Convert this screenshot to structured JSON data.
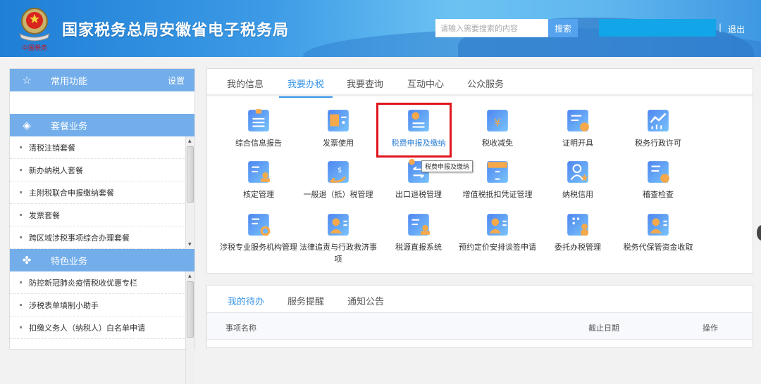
{
  "header": {
    "title": "国家税务总局安徽省电子税务局",
    "logo_text": "中国税务",
    "search_placeholder": "请输入需要搜索的内容",
    "search_button": "搜索",
    "separator": "|",
    "logout": "退出"
  },
  "sidebar": {
    "common": {
      "title": "常用功能",
      "settings": "设置",
      "icon": "star-icon"
    },
    "package": {
      "title": "套餐业务",
      "icon": "layers-icon",
      "items": [
        "清税注销套餐",
        "新办纳税人套餐",
        "主附税联合申报缴纳套餐",
        "发票套餐",
        "跨区域涉税事项综合办理套餐"
      ]
    },
    "special": {
      "title": "特色业务",
      "icon": "clover-icon",
      "items": [
        "防控新冠肺炎疫情税收优惠专栏",
        "涉税表单填制小助手",
        "扣缴义务人（纳税人）白名单申请"
      ]
    }
  },
  "main": {
    "tabs": [
      "我的信息",
      "我要办税",
      "我要查询",
      "互动中心",
      "公众服务"
    ],
    "active_tab": "我要办税",
    "services": [
      {
        "label": "综合信息报告",
        "icon": "clipboard-icon"
      },
      {
        "label": "发票使用",
        "icon": "invoice-icon"
      },
      {
        "label": "税费申报及缴纳",
        "icon": "document-plus-icon"
      },
      {
        "label": "税收减免",
        "icon": "yen-ticket-icon"
      },
      {
        "label": "证明开具",
        "icon": "certificate-icon"
      },
      {
        "label": "税务行政许可",
        "icon": "chart-trend-icon"
      },
      {
        "label": "核定管理",
        "icon": "document-stamp-icon"
      },
      {
        "label": "一般退（抵）税管理",
        "icon": "money-return-icon"
      },
      {
        "label": "出口退税管理",
        "icon": "exchange-doc-icon"
      },
      {
        "label": "增值税抵扣凭证管理",
        "icon": "cabinet-icon"
      },
      {
        "label": "纳税信用",
        "icon": "user-star-icon"
      },
      {
        "label": "稽查检查",
        "icon": "document-check-icon"
      },
      {
        "label": "涉税专业服务机构管理",
        "icon": "document-gear-icon"
      },
      {
        "label": "法律追责与行政救济事项",
        "icon": "id-card-icon"
      },
      {
        "label": "税源直报系统",
        "icon": "document-stamp-icon"
      },
      {
        "label": "预约定价安排谈签申请",
        "icon": "id-card-icon"
      },
      {
        "label": "委托办税管理",
        "icon": "building-person-icon"
      },
      {
        "label": "税务代保管资金收取",
        "icon": "id-card-icon"
      }
    ],
    "highlighted": "税费申报及缴纳",
    "tooltip": "税费申报及缴纳"
  },
  "todo": {
    "tabs": [
      "我的待办",
      "服务提醒",
      "通知公告"
    ],
    "active_tab": "我的待办",
    "columns": [
      "事项名称",
      "截止日期",
      "操作"
    ]
  },
  "colors": {
    "header_blue": "#3c9ae6",
    "sidebar_header": "#73aeea",
    "accent": "#3a95e8",
    "highlight_border": "#e0151c",
    "icon_orange": "#f6a94a"
  }
}
